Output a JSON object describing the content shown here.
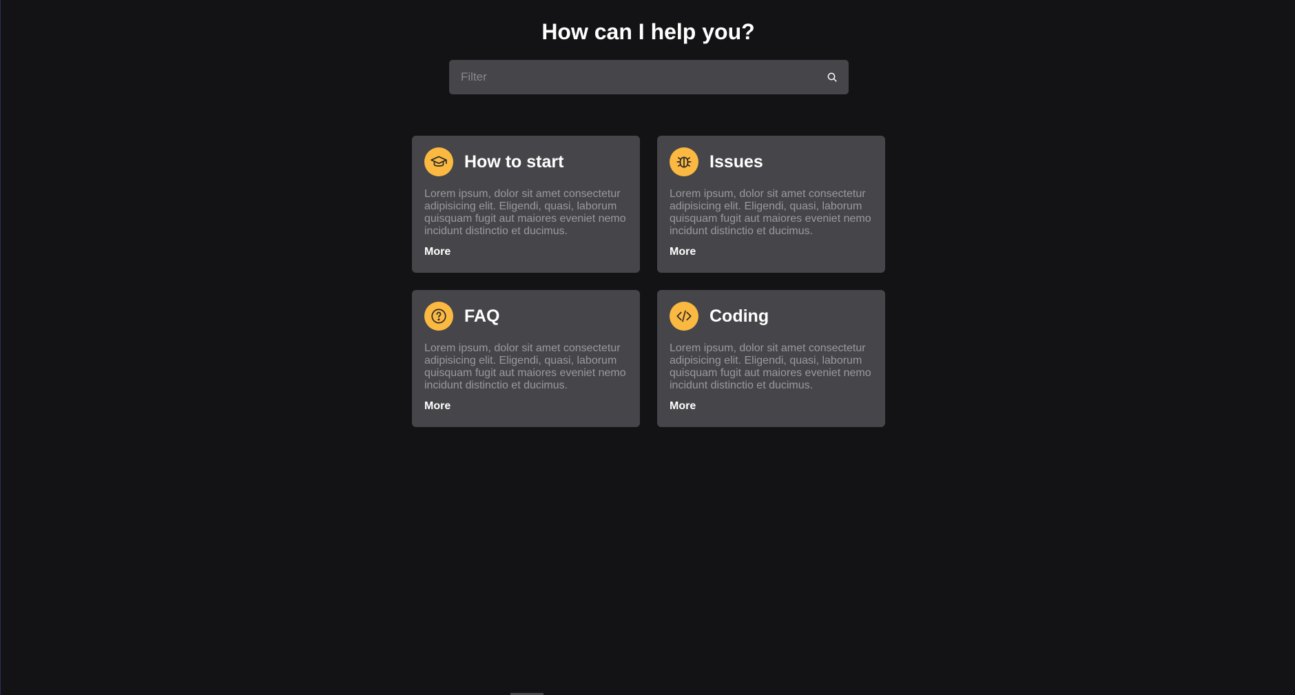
{
  "header": {
    "title": "How can I help you?"
  },
  "search": {
    "placeholder": "Filter",
    "value": "",
    "icon": "search-icon"
  },
  "colors": {
    "background": "#131315",
    "card": "#46464a",
    "accent": "#fcb942"
  },
  "cards": [
    {
      "icon": "graduation-cap-icon",
      "title": "How to start",
      "description": "Lorem ipsum, dolor sit amet consectetur adipisicing elit. Eligendi, quasi, laborum quisquam fugit aut maiores eveniet nemo incidunt distinctio et ducimus.",
      "more_label": "More"
    },
    {
      "icon": "bug-icon",
      "title": "Issues",
      "description": "Lorem ipsum, dolor sit amet consectetur adipisicing elit. Eligendi, quasi, laborum quisquam fugit aut maiores eveniet nemo incidunt distinctio et ducimus.",
      "more_label": "More"
    },
    {
      "icon": "question-circle-icon",
      "title": "FAQ",
      "description": "Lorem ipsum, dolor sit amet consectetur adipisicing elit. Eligendi, quasi, laborum quisquam fugit aut maiores eveniet nemo incidunt distinctio et ducimus.",
      "more_label": "More"
    },
    {
      "icon": "code-icon",
      "title": "Coding",
      "description": "Lorem ipsum, dolor sit amet consectetur adipisicing elit. Eligendi, quasi, laborum quisquam fugit aut maiores eveniet nemo incidunt distinctio et ducimus.",
      "more_label": "More"
    }
  ]
}
